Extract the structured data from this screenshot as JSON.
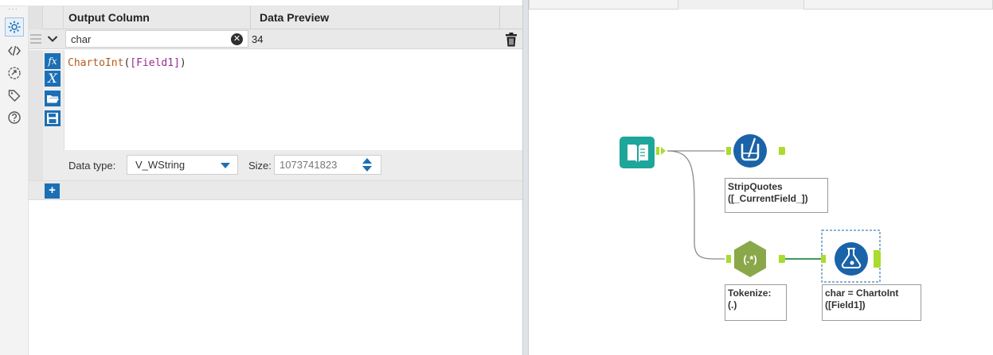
{
  "formula_config": {
    "columns": {
      "output_column": "Output Column",
      "data_preview": "Data Preview"
    },
    "rows": [
      {
        "output_name": "char",
        "preview": "34",
        "expression": {
          "function": "ChartoInt",
          "open": "(",
          "field": "[Field1]",
          "close": ")"
        },
        "data_type_label": "Data type:",
        "data_type": "V_WString",
        "size_label": "Size:",
        "size": "1073741823"
      }
    ],
    "add_button": "+",
    "clear_glyph": "✕",
    "tools": {
      "fx": "fx",
      "variable": "X"
    }
  },
  "workflow": {
    "tools": [
      {
        "name": "input-data-tool",
        "icon": "book-icon",
        "color": "#1ea69a"
      },
      {
        "name": "multi-field-formula-tool",
        "icon": "beaker-icon",
        "color": "#1a63a8"
      },
      {
        "name": "regex-tool",
        "icon": "regex-icon",
        "color": "#8aa84a",
        "glyph": "(.*)"
      },
      {
        "name": "formula-tool",
        "icon": "flask-icon",
        "color": "#1a63a8"
      }
    ],
    "annotations": {
      "strip_quotes_line1": "StripQuotes",
      "strip_quotes_line2": "([_CurrentField_])",
      "tokenize_line1": "Tokenize:",
      "tokenize_line2": "(.)",
      "formula_line1": "char = ChartoInt",
      "formula_line2": "([Field1])"
    },
    "connector_color": "#aadb2f",
    "connection_color": "#8a8a8a",
    "active_connection_color": "#3a9a5a"
  }
}
